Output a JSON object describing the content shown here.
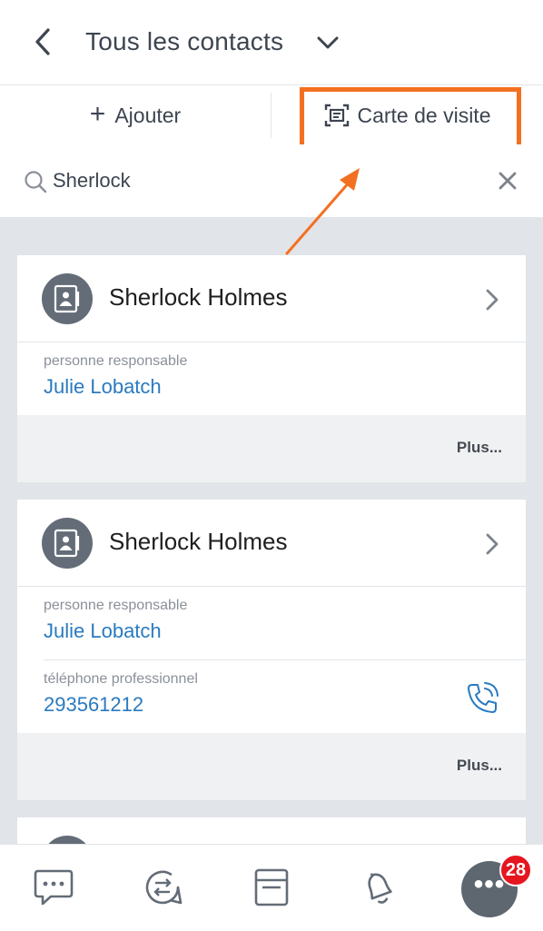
{
  "header": {
    "title": "Tous les contacts"
  },
  "actions": {
    "add_label": "Ajouter",
    "business_card_label": "Carte de visite"
  },
  "search": {
    "value": "Sherlock",
    "placeholder": ""
  },
  "contacts": [
    {
      "name": "Sherlock Holmes",
      "fields": [
        {
          "label": "personne responsable",
          "value": "Julie Lobatch"
        }
      ],
      "more_label": "Plus..."
    },
    {
      "name": "Sherlock Holmes",
      "fields": [
        {
          "label": "personne responsable",
          "value": "Julie Lobatch"
        },
        {
          "label": "téléphone professionnel",
          "value": "293561212"
        }
      ],
      "more_label": "Plus..."
    }
  ],
  "bottom_nav": {
    "items": [
      "chat-icon",
      "activity-stream-icon",
      "tasks-icon",
      "notifications-icon",
      "more-icon"
    ],
    "badge_count": "28"
  },
  "colors": {
    "highlight": "#f37021",
    "link": "#2a7ac0",
    "badge": "#e5161f",
    "list_background": "#e1e4e8"
  }
}
